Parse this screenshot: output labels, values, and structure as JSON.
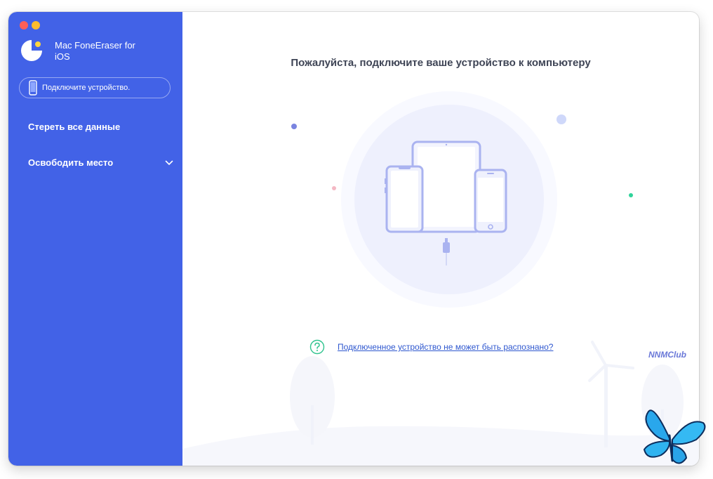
{
  "app": {
    "name": "Mac FoneEraser for iOS"
  },
  "sidebar": {
    "device_status": "Подключите устройство.",
    "items": [
      {
        "label": "Стереть все данные"
      },
      {
        "label": "Освободить место"
      }
    ]
  },
  "main": {
    "heading": "Пожалуйста, подключите ваше устройство к компьютеру",
    "help_link": "Подключенное устройство не может быть распознано?"
  },
  "watermark": "NNMClub",
  "icons": {
    "close": "red-circle",
    "minimize": "yellow-circle",
    "logo": "foneeraser-logo",
    "device": "phone-icon",
    "chevron": "chevron-down-icon",
    "help": "question-circle-icon"
  },
  "colors": {
    "sidebar": "#4262e7",
    "accent": "#2e57cf",
    "help_icon": "#2fc38e"
  }
}
